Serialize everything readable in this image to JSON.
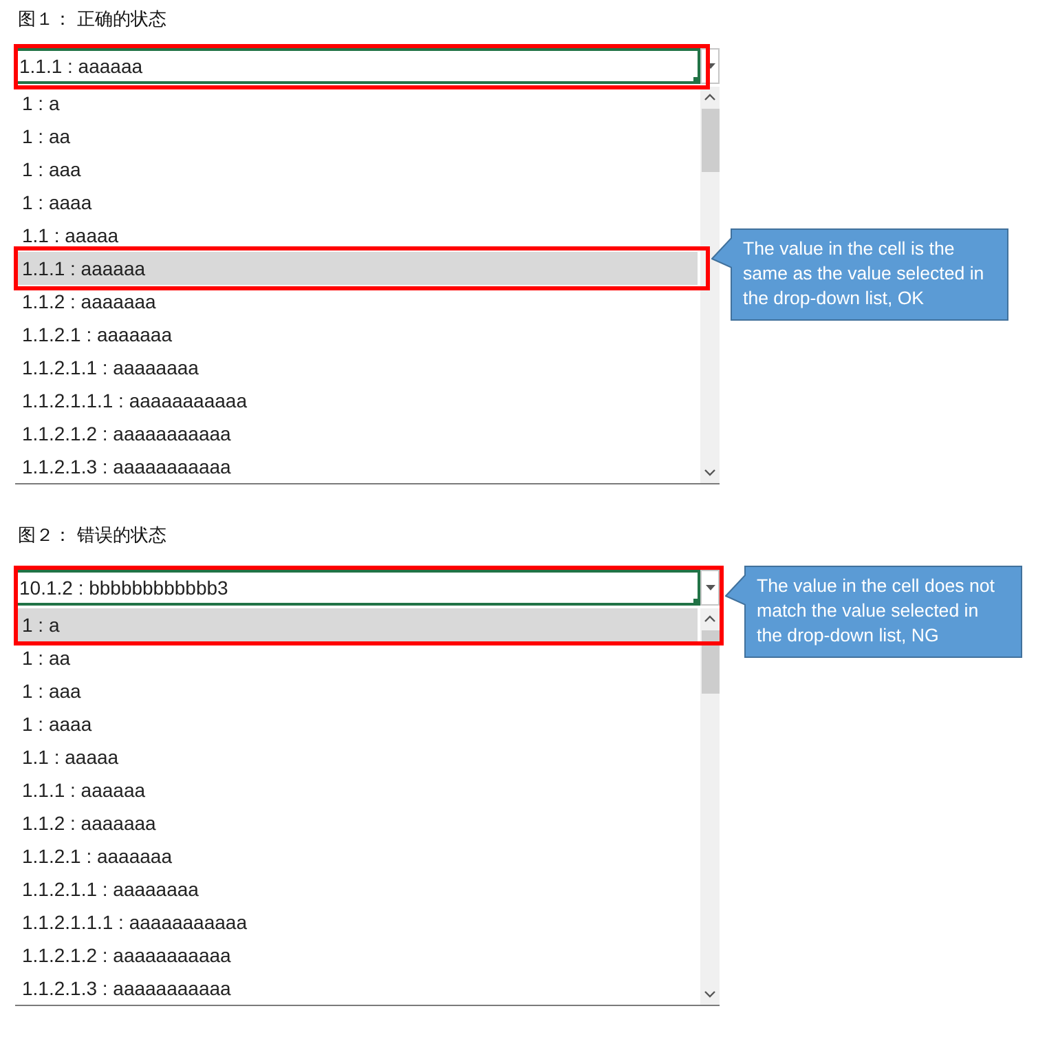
{
  "figures": [
    {
      "caption": "图１： 正确的状态",
      "cell": {
        "value": "1.1.1 : aaaaaa"
      },
      "list": {
        "items": [
          {
            "text": "1 : a",
            "selected": false
          },
          {
            "text": "1 : aa",
            "selected": false
          },
          {
            "text": "1 : aaa",
            "selected": false
          },
          {
            "text": "1 : aaaa",
            "selected": false
          },
          {
            "text": "1.1 : aaaaa",
            "selected": false
          },
          {
            "text": "1.1.1 : aaaaaa",
            "selected": true
          },
          {
            "text": "1.1.2 : aaaaaaa",
            "selected": false
          },
          {
            "text": "1.1.2.1 : aaaaaaa",
            "selected": false
          },
          {
            "text": "1.1.2.1.1 : aaaaaaaa",
            "selected": false
          },
          {
            "text": "1.1.2.1.1.1 : aaaaaaaaaaa",
            "selected": false
          },
          {
            "text": "1.1.2.1.2 : aaaaaaaaaaa",
            "selected": false
          },
          {
            "text": "1.1.2.1.3 : aaaaaaaaaaa",
            "selected": false
          }
        ]
      },
      "callout": {
        "text": "The value in the cell is the same as the value selected in the drop-down list, OK"
      }
    },
    {
      "caption": "图２： 错误的状态",
      "cell": {
        "value": "10.1.2 : bbbbbbbbbbbb3"
      },
      "list": {
        "items": [
          {
            "text": "1 : a",
            "selected": true
          },
          {
            "text": "1 : aa",
            "selected": false
          },
          {
            "text": "1 : aaa",
            "selected": false
          },
          {
            "text": "1 : aaaa",
            "selected": false
          },
          {
            "text": "1.1 : aaaaa",
            "selected": false
          },
          {
            "text": "1.1.1 : aaaaaa",
            "selected": false
          },
          {
            "text": "1.1.2 : aaaaaaa",
            "selected": false
          },
          {
            "text": "1.1.2.1 : aaaaaaa",
            "selected": false
          },
          {
            "text": "1.1.2.1.1 : aaaaaaaa",
            "selected": false
          },
          {
            "text": "1.1.2.1.1.1 : aaaaaaaaaaa",
            "selected": false
          },
          {
            "text": "1.1.2.1.2 : aaaaaaaaaaa",
            "selected": false
          },
          {
            "text": "1.1.2.1.3 : aaaaaaaaaaa",
            "selected": false
          }
        ]
      },
      "callout": {
        "text": "The value in the cell does not match the value selected in the drop-down list, NG"
      }
    }
  ]
}
